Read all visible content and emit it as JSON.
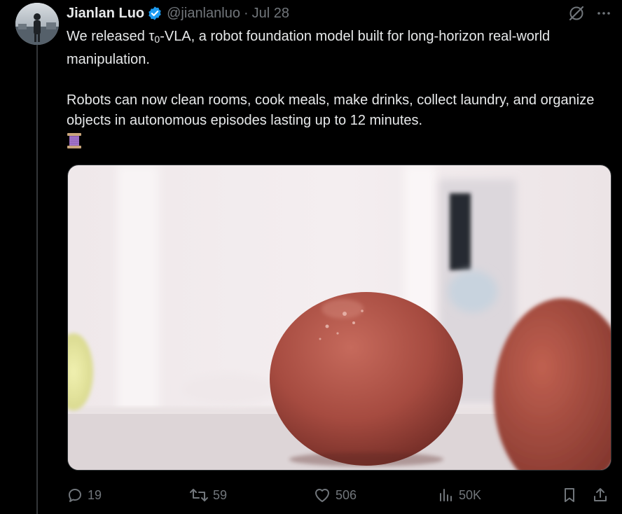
{
  "author": {
    "display_name": "Jianlan Luo",
    "handle": "@jianlanluo",
    "separator": "·",
    "date": "Jul 28",
    "verified": true
  },
  "tweet": {
    "text_line1_before": "We released ",
    "text_tau": "τ",
    "text_subscript": "0",
    "text_line1_after": "-VLA, a robot foundation model built for long-horizon real-world manipulation.",
    "text_paragraph2": "Robots can now clean rooms, cook meals, make drinks, collect laundry, and organize objects in autonomous episodes lasting up to 12 minutes.",
    "emoji": "spool-of-thread-emoji"
  },
  "media": {
    "kind": "video-still",
    "subject": "tomato"
  },
  "actions": {
    "reply_count": "19",
    "retweet_count": "59",
    "like_count": "506",
    "view_count": "50K"
  },
  "icons": [
    "grok-icon",
    "more-icon",
    "reply-icon",
    "retweet-icon",
    "like-icon",
    "views-icon",
    "bookmark-icon",
    "share-icon"
  ],
  "colors": {
    "background": "#000000",
    "text": "#e7e9ea",
    "muted": "#71767b",
    "verified": "#1d9bf0"
  }
}
